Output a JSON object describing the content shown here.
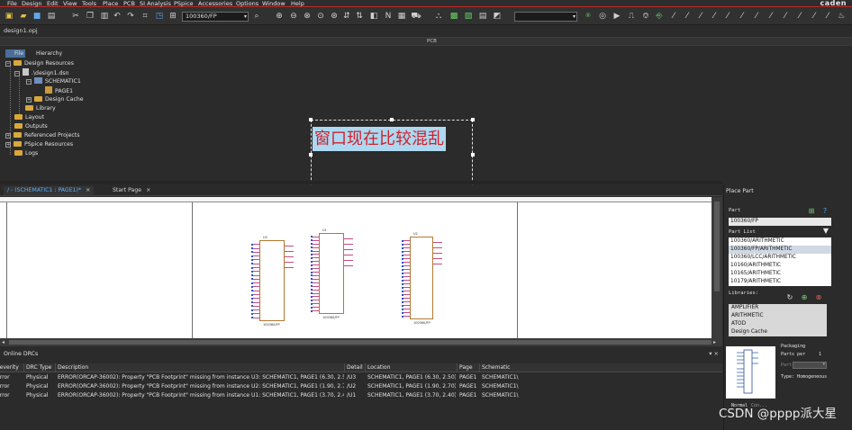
{
  "menubar": {
    "items": [
      "File",
      "Design",
      "Edit",
      "View",
      "Tools",
      "Place",
      "PCB",
      "SI Analysis",
      "PSpice",
      "Accessories",
      "Options",
      "Window",
      "Help"
    ],
    "brand": "caden"
  },
  "toolbar": {
    "part_selector_value": "100360/FP"
  },
  "project": {
    "tab_label": "design1.opj",
    "pcb_strip_label": "PCB"
  },
  "tree": {
    "tabs": [
      "File",
      "Hierarchy"
    ],
    "rows": [
      "Design Resources",
      ".\\design1.dsn",
      "SCHEMATIC1",
      "PAGE1",
      "Design Cache",
      "Library",
      "Layout",
      "Outputs",
      "Referenced Projects",
      "PSpice Resources",
      "Logs"
    ]
  },
  "overlay": {
    "text": "窗口现在比较混乱"
  },
  "doc_tabs": {
    "items": [
      {
        "label": "/ - (SCHEMATIC1 : PAGE1)*"
      },
      {
        "label": "Start Page"
      }
    ]
  },
  "schematic": {
    "parts": [
      {
        "ref": "U3",
        "value": "100360/FP"
      },
      {
        "ref": "U1",
        "value": "100360/FP"
      },
      {
        "ref": "U2",
        "value": "100360/FP"
      }
    ]
  },
  "drc": {
    "title": "Online DRCs",
    "columns": [
      "Severity",
      "DRC Type",
      "Description",
      "Detail",
      "Location",
      "Page",
      "Schematic"
    ],
    "rows": [
      [
        "Error",
        "Physical",
        "ERROR(ORCAP-36002): Property \"PCB Footprint\" missing from instance U3: SCHEMATIC1, PAGE1 (6.30, 2.50).",
        "/U3",
        "SCHEMATIC1, PAGE1   (6.30, 2.50)",
        "PAGE1",
        "SCHEMATIC1\\"
      ],
      [
        "Error",
        "Physical",
        "ERROR(ORCAP-36002): Property \"PCB Footprint\" missing from instance U2: SCHEMATIC1, PAGE1 (1.90, 2.70).",
        "/U2",
        "SCHEMATIC1, PAGE1   (1.90, 2.70)",
        "PAGE1",
        "SCHEMATIC1\\"
      ],
      [
        "Error",
        "Physical",
        "ERROR(ORCAP-36002): Property \"PCB Footprint\" missing from instance U1: SCHEMATIC1, PAGE1 (3.70, 2.40).",
        "/U1",
        "SCHEMATIC1, PAGE1   (3.70, 2.40)",
        "PAGE1",
        "SCHEMATIC1\\"
      ]
    ]
  },
  "place_part": {
    "title": "Place Part",
    "part_label": "Part",
    "part_value": "100360/FP",
    "part_list_label": "Part List",
    "parts": [
      "100360/ARITHMETIC",
      "100360/FP/ARITHMETIC",
      "100360/LCC/ARITHMETIC",
      "10160/ARITHMETIC",
      "10165/ARITHMETIC",
      "10179/ARITHMETIC"
    ],
    "libraries_label": "Libraries:",
    "libraries": [
      "AMPLIFIER",
      "ARITHMETIC",
      "ATOD",
      "Design Cache"
    ],
    "packaging_label": "Packaging",
    "parts_per_label": "Parts per",
    "parts_per_value": "1",
    "part_label2": "Part:",
    "type_label": "Type: Homogeneous",
    "normal_label": "Normal",
    "convert_label": "Con..."
  },
  "watermark": "CSDN @pppp派大星"
}
